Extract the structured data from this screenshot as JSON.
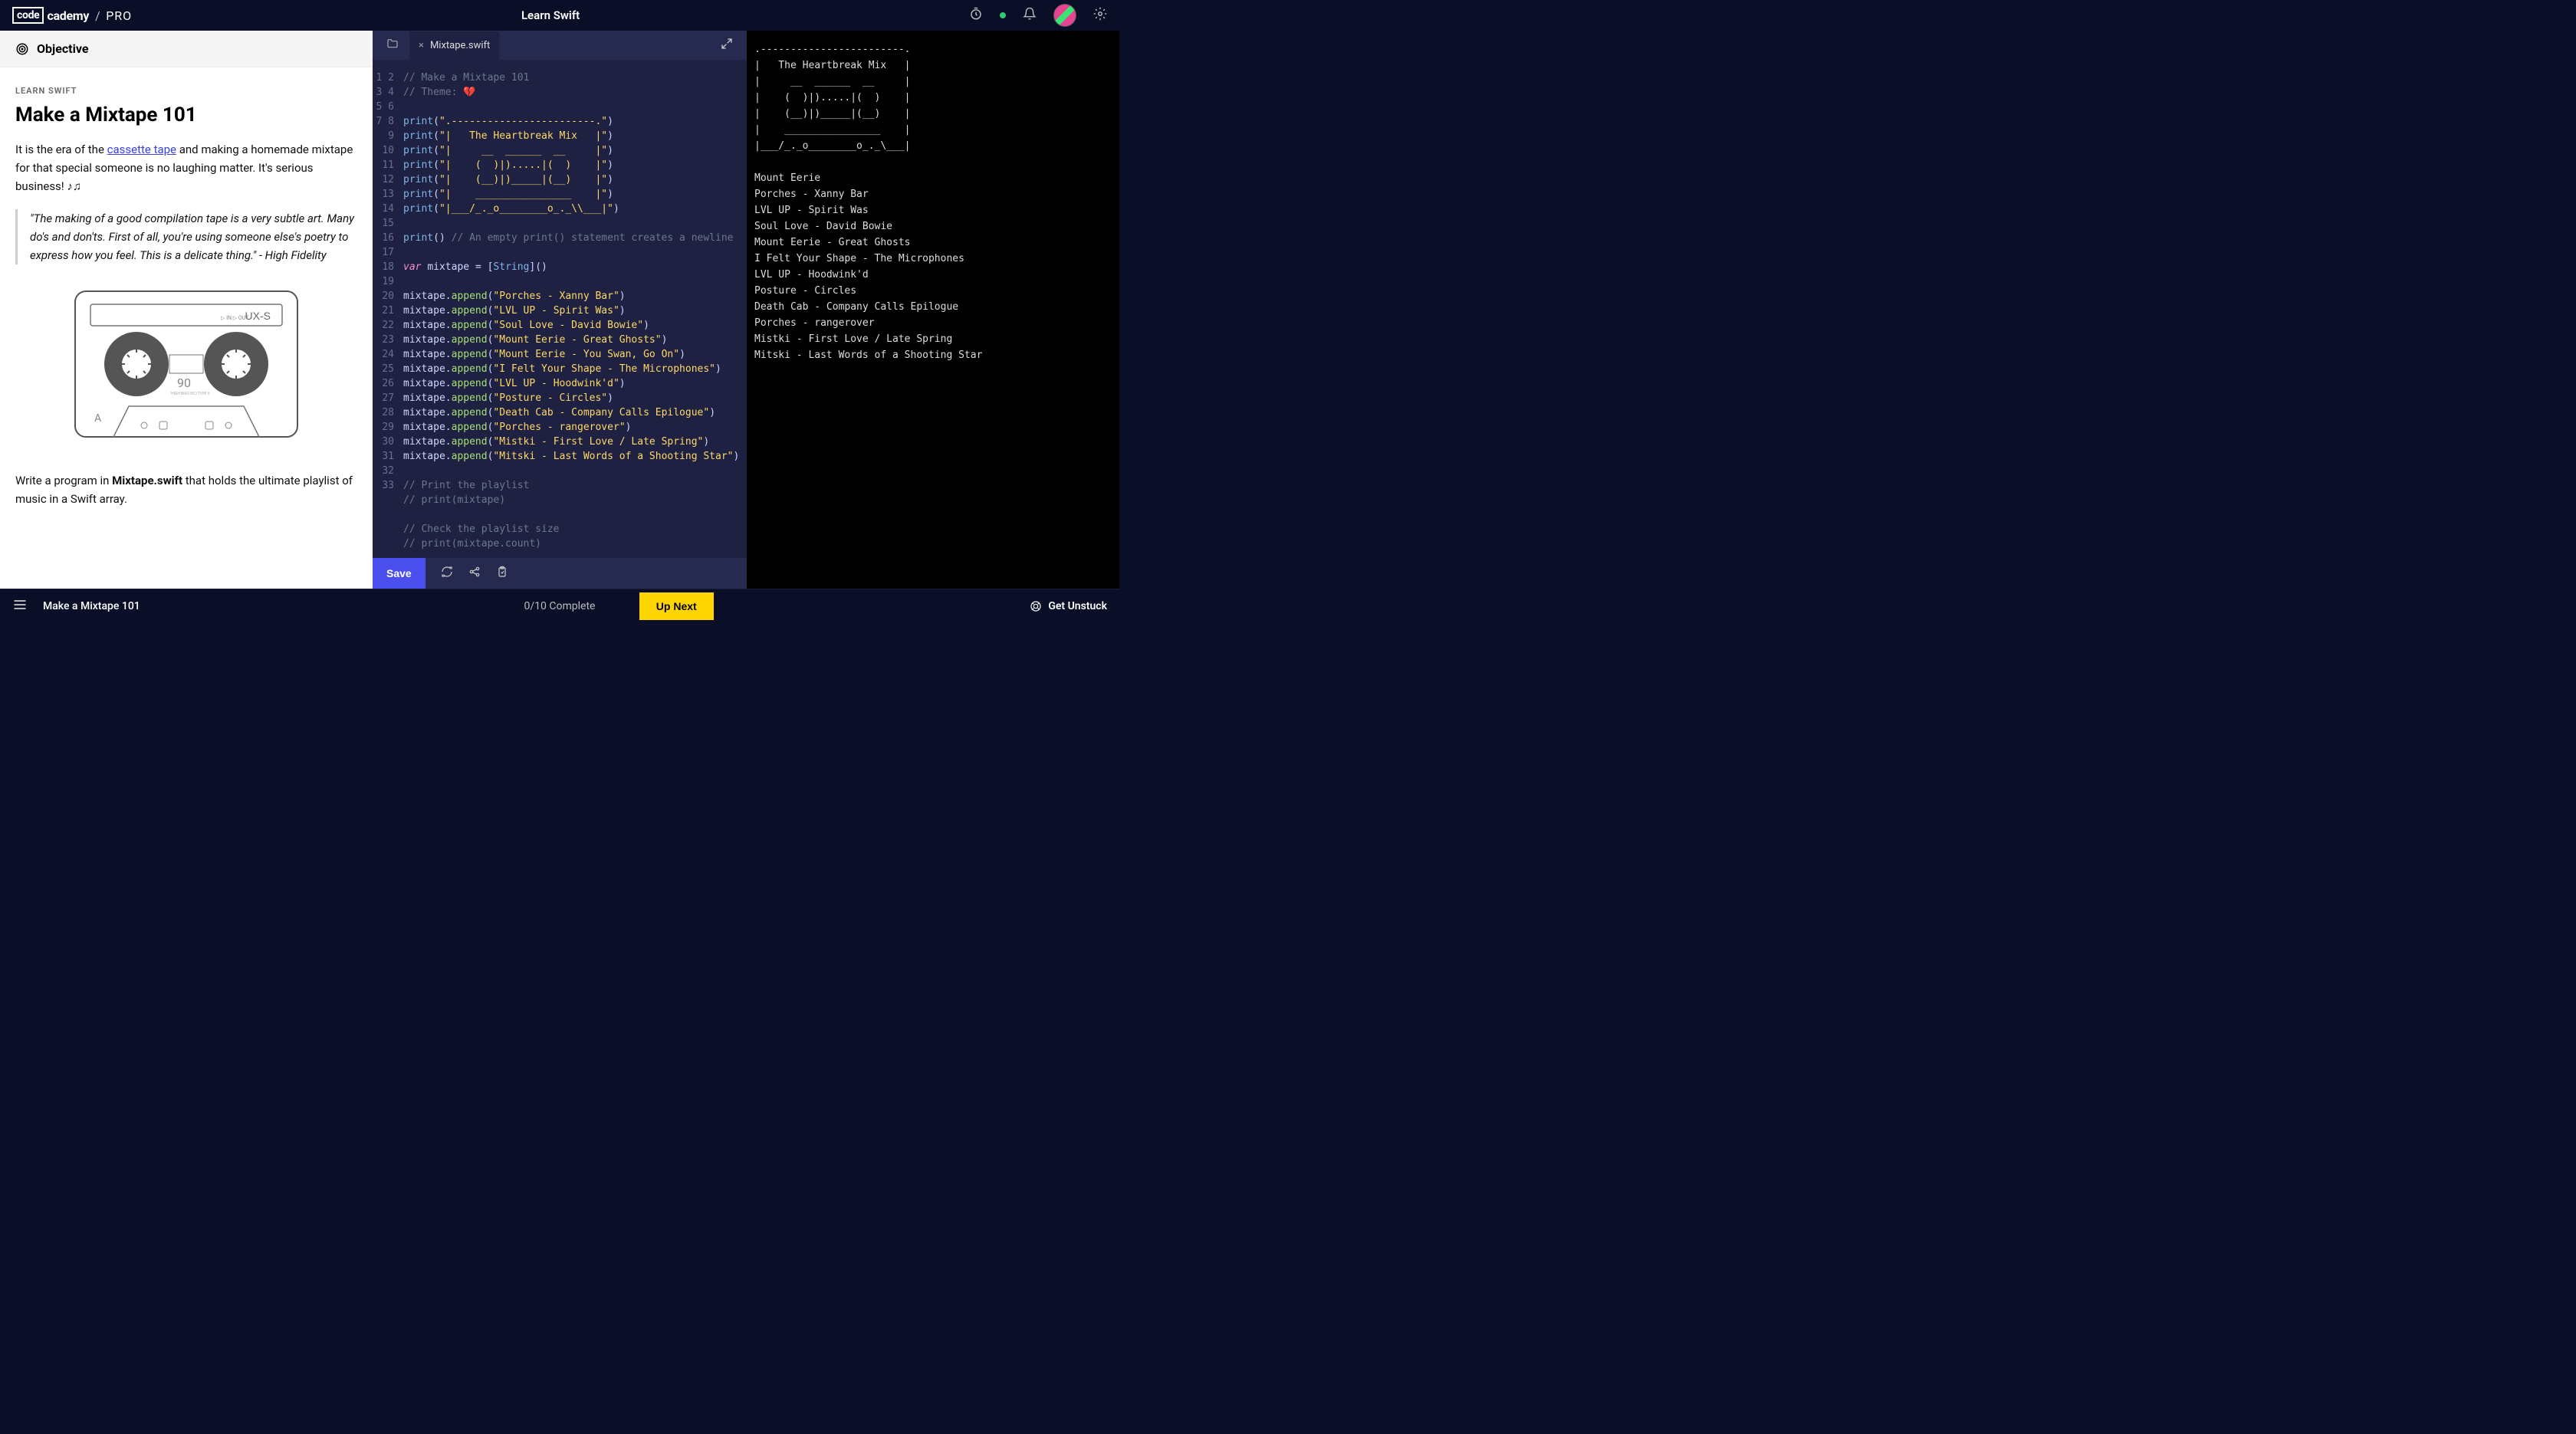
{
  "header": {
    "brand_box": "code",
    "brand_rest": "cademy",
    "brand_suffix": "PRO",
    "course_title": "Learn Swift"
  },
  "left": {
    "objective_label": "Objective",
    "breadcrumb": "LEARN SWIFT",
    "title": "Make a Mixtape 101",
    "intro_pre": "It is the era of the ",
    "intro_link": "cassette tape",
    "intro_post": " and making a homemade mixtape for that special someone is no laughing matter. It's serious business! ♪♫",
    "quote": "\"The making of a good compilation tape is a very subtle art. Many do's and don'ts. First of all, you're using someone else's poetry to express how you feel. This is a delicate thing.\" - High Fidelity",
    "instruction_pre": "Write a program in ",
    "instruction_file": "Mixtape.swift",
    "instruction_post": " that holds the ultimate playlist of music in a Swift array."
  },
  "editor": {
    "tab_name": "Mixtape.swift",
    "lines": [
      {
        "n": 1,
        "t": "comment",
        "raw": "// Make a Mixtape 101"
      },
      {
        "n": 2,
        "t": "comment",
        "raw": "// Theme: 💔"
      },
      {
        "n": 3,
        "t": "blank"
      },
      {
        "n": 4,
        "t": "print",
        "arg": "\".------------------------.\""
      },
      {
        "n": 5,
        "t": "print",
        "arg": "\"|   The Heartbreak Mix   |\""
      },
      {
        "n": 6,
        "t": "print",
        "arg": "\"|     __  ______  __     |\""
      },
      {
        "n": 7,
        "t": "print",
        "arg": "\"|    (  )|).....|(  )    |\""
      },
      {
        "n": 8,
        "t": "print",
        "arg": "\"|    (__)|)_____|(__)    |\""
      },
      {
        "n": 9,
        "t": "print",
        "arg": "\"|    ________________    |\""
      },
      {
        "n": 10,
        "t": "print",
        "arg": "\"|___/_._o________o_._\\\\___|\""
      },
      {
        "n": 11,
        "t": "blank"
      },
      {
        "n": 12,
        "t": "printempty",
        "comment": "// An empty print() statement creates a newline"
      },
      {
        "n": 13,
        "t": "blank"
      },
      {
        "n": 14,
        "t": "vardecl"
      },
      {
        "n": 15,
        "t": "blank"
      },
      {
        "n": 16,
        "t": "append",
        "arg": "\"Porches - Xanny Bar\""
      },
      {
        "n": 17,
        "t": "append",
        "arg": "\"LVL UP - Spirit Was\""
      },
      {
        "n": 18,
        "t": "append",
        "arg": "\"Soul Love - David Bowie\""
      },
      {
        "n": 19,
        "t": "append",
        "arg": "\"Mount Eerie - Great Ghosts\""
      },
      {
        "n": 20,
        "t": "append",
        "arg": "\"Mount Eerie - You Swan, Go On\""
      },
      {
        "n": 21,
        "t": "append",
        "arg": "\"I Felt Your Shape - The Microphones\""
      },
      {
        "n": 22,
        "t": "append",
        "arg": "\"LVL UP - Hoodwink'd\""
      },
      {
        "n": 23,
        "t": "append",
        "arg": "\"Posture - Circles\""
      },
      {
        "n": 24,
        "t": "append",
        "arg": "\"Death Cab - Company Calls Epilogue\""
      },
      {
        "n": 25,
        "t": "append",
        "arg": "\"Porches - rangerover\""
      },
      {
        "n": 26,
        "t": "append",
        "arg": "\"Mistki - First Love / Late Spring\""
      },
      {
        "n": 27,
        "t": "append",
        "arg": "\"Mitski - Last Words of a Shooting Star\""
      },
      {
        "n": 28,
        "t": "blank"
      },
      {
        "n": 29,
        "t": "comment",
        "raw": "// Print the playlist"
      },
      {
        "n": 30,
        "t": "comment",
        "raw": "// print(mixtape)"
      },
      {
        "n": 31,
        "t": "blank"
      },
      {
        "n": 32,
        "t": "comment",
        "raw": "// Check the playlist size"
      },
      {
        "n": 33,
        "t": "comment",
        "raw": "// print(mixtape.count)"
      }
    ],
    "save_label": "Save"
  },
  "output_lines": [
    ".------------------------.",
    "|   The Heartbreak Mix   |",
    "|     __  ______  __     |",
    "|    (  )|).....|(  )    |",
    "|    (__)|)_____|(__)    |",
    "|    ________________    |",
    "|___/_._o________o_._\\___|",
    "",
    "Mount Eerie",
    "Porches - Xanny Bar",
    "LVL UP - Spirit Was",
    "Soul Love - David Bowie",
    "Mount Eerie - Great Ghosts",
    "I Felt Your Shape - The Microphones",
    "LVL UP - Hoodwink'd",
    "Posture - Circles",
    "Death Cab - Company Calls Epilogue",
    "Porches - rangerover",
    "Mistki - First Love / Late Spring",
    "Mitski - Last Words of a Shooting Star"
  ],
  "bottom": {
    "title": "Make a Mixtape 101",
    "progress": "0/10 Complete",
    "up_next": "Up Next",
    "get_unstuck": "Get Unstuck"
  }
}
